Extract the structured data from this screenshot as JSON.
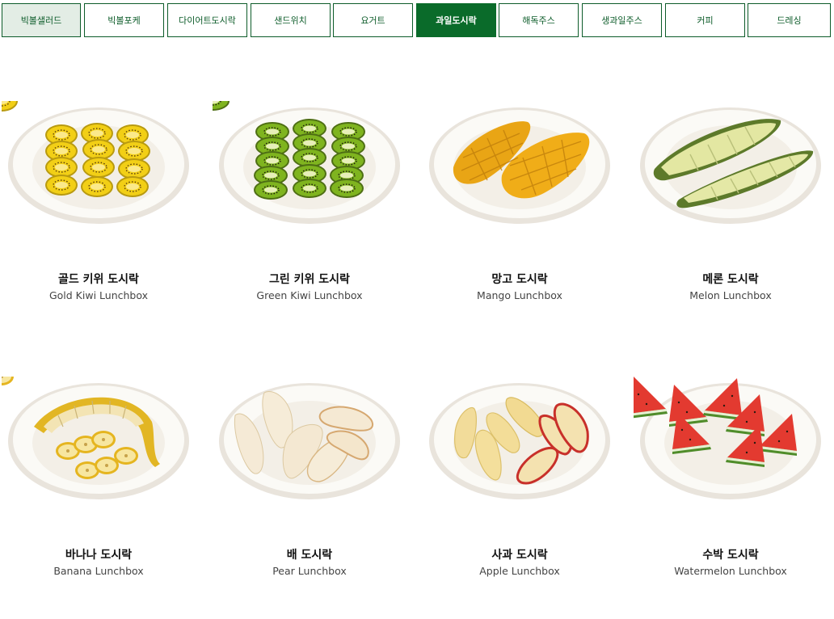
{
  "tabs": [
    {
      "label": "빅볼샐러드"
    },
    {
      "label": "빅볼포케"
    },
    {
      "label": "다이어트도시락"
    },
    {
      "label": "샌드위치"
    },
    {
      "label": "요거트"
    },
    {
      "label": "과일도시락",
      "active": true
    },
    {
      "label": "해독주스"
    },
    {
      "label": "생과일주스"
    },
    {
      "label": "커피"
    },
    {
      "label": "드레싱"
    }
  ],
  "colors": {
    "brand_green": "#0a6b2a",
    "first_tab_bg": "#e3ede5"
  },
  "products": [
    {
      "name_ko": "골드 키위 도시락",
      "name_en": "Gold Kiwi Lunchbox",
      "image": "gold-kiwi-plate"
    },
    {
      "name_ko": "그린 키위 도시락",
      "name_en": "Green Kiwi Lunchbox",
      "image": "green-kiwi-plate"
    },
    {
      "name_ko": "망고 도시락",
      "name_en": "Mango Lunchbox",
      "image": "mango-plate"
    },
    {
      "name_ko": "메론 도시락",
      "name_en": "Melon Lunchbox",
      "image": "melon-plate"
    },
    {
      "name_ko": "바나나 도시락",
      "name_en": "Banana Lunchbox",
      "image": "banana-plate"
    },
    {
      "name_ko": "배 도시락",
      "name_en": "Pear Lunchbox",
      "image": "pear-plate"
    },
    {
      "name_ko": "사과 도시락",
      "name_en": "Apple Lunchbox",
      "image": "apple-plate"
    },
    {
      "name_ko": "수박 도시락",
      "name_en": "Watermelon Lunchbox",
      "image": "watermelon-plate"
    }
  ]
}
